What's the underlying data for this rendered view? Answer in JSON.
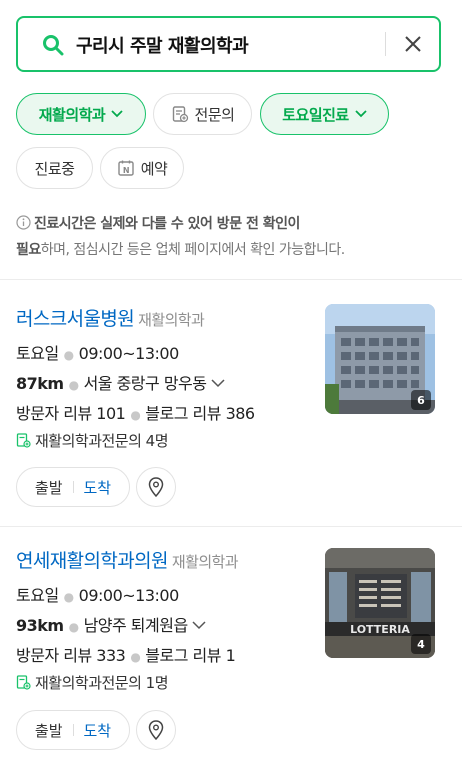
{
  "search": {
    "query": "구리시 주말 재활의학과"
  },
  "filters": [
    {
      "label": "재활의학과",
      "active": true,
      "icon": "chevron-down-icon"
    },
    {
      "label": "전문의",
      "active": false,
      "icon": "specialist-doc-icon"
    },
    {
      "label": "토요일진료",
      "active": true,
      "icon": "chevron-down-icon"
    },
    {
      "label": "진료중",
      "active": false
    },
    {
      "label": "예약",
      "active": false,
      "icon": "naver-booking-icon"
    }
  ],
  "notice": {
    "bold1": "진료시간은 실제와 다를 수 있어 방문 전 확인이",
    "bold2": "필요",
    "rest": "하며, 점심시간 등은 업체 페이지에서 확인 가능합니다."
  },
  "places": [
    {
      "name": "러스크서울병원",
      "category": "재활의학과",
      "day": "토요일",
      "hours": "09:00~13:00",
      "distance": "87km",
      "address": "서울 중랑구 망우동",
      "visitor_reviews": "방문자 리뷰 101",
      "blog_reviews": "블로그 리뷰 386",
      "specialists": "재활의학과전문의 4명",
      "photo_count": "6",
      "start_label": "출발",
      "arrive_label": "도착"
    },
    {
      "name": "연세재활의학과의원",
      "category": "재활의학과",
      "day": "토요일",
      "hours": "09:00~13:00",
      "distance": "93km",
      "address": "남양주 퇴계원읍",
      "visitor_reviews": "방문자 리뷰 333",
      "blog_reviews": "블로그 리뷰 1",
      "specialists": "재활의학과전문의 1명",
      "photo_count": "4",
      "start_label": "출발",
      "arrive_label": "도착"
    }
  ],
  "colors": {
    "accent": "#19c26a",
    "link": "#0068c3"
  }
}
